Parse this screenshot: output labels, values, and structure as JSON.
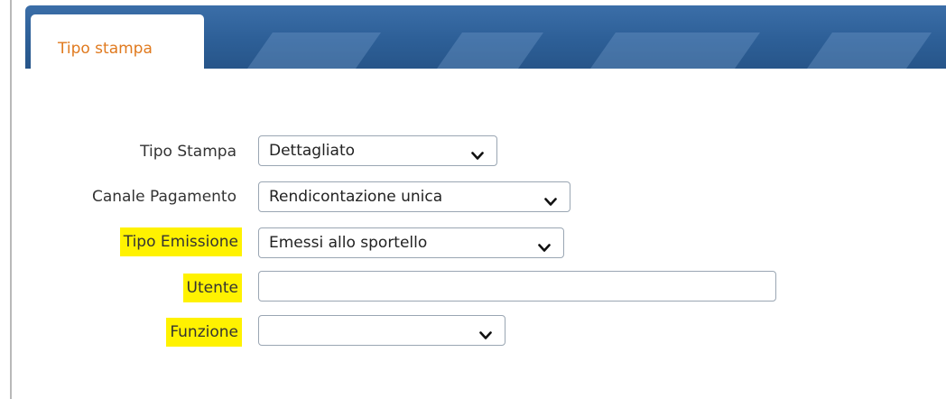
{
  "tab": {
    "label": "Tipo stampa"
  },
  "form": {
    "tipo_stampa": {
      "label": "Tipo Stampa",
      "value": "Dettagliato"
    },
    "canale_pagamento": {
      "label": "Canale Pagamento",
      "value": "Rendicontazione unica"
    },
    "tipo_emissione": {
      "label": "Tipo Emissione",
      "value": "Emessi allo sportello"
    },
    "utente": {
      "label": "Utente",
      "value": ""
    },
    "funzione": {
      "label": "Funzione",
      "value": ""
    }
  },
  "colors": {
    "tab_text": "#e07a1f",
    "highlight": "#fff200",
    "header": "#2d5f97"
  },
  "icons": {
    "dropdown": "chevron-down-icon"
  }
}
